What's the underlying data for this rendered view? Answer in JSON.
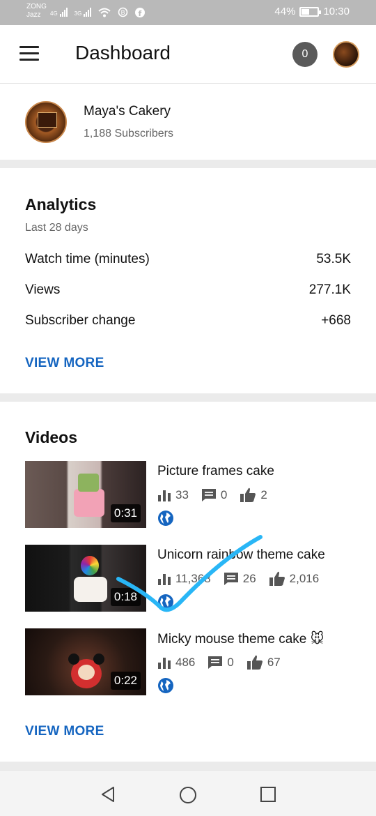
{
  "status_bar": {
    "carrier_line1": "ZONG",
    "carrier_line2": "Jazz",
    "network1": "4G",
    "network2": "3G",
    "battery": "44%",
    "battery_level": 0.44,
    "time": "10:30"
  },
  "app_bar": {
    "title": "Dashboard",
    "notification_count": "0"
  },
  "channel": {
    "name": "Maya's Cakery",
    "subscribers": "1,188 Subscribers"
  },
  "analytics": {
    "title": "Analytics",
    "period": "Last 28 days",
    "rows": [
      {
        "label": "Watch time (minutes)",
        "value": "53.5K"
      },
      {
        "label": "Views",
        "value": "277.1K"
      },
      {
        "label": "Subscriber change",
        "value": "+668"
      }
    ],
    "view_more": "VIEW MORE"
  },
  "videos": {
    "title": "Videos",
    "items": [
      {
        "title": "Picture frames cake",
        "duration": "0:31",
        "views": "33",
        "comments": "0",
        "likes": "2"
      },
      {
        "title": "Unicorn rainbow theme cake",
        "duration": "0:18",
        "views": "11,368",
        "comments": "26",
        "likes": "2,016"
      },
      {
        "title": "Micky mouse theme cake 🐭",
        "duration": "0:22",
        "views": "486",
        "comments": "0",
        "likes": "67"
      }
    ],
    "view_more": "VIEW MORE"
  },
  "colors": {
    "accent": "#1565c0",
    "annotation": "#29b6f6"
  },
  "icons": [
    "menu-icon",
    "bar-chart-icon",
    "comment-icon",
    "thumbs-up-icon",
    "globe-icon",
    "back-icon",
    "home-icon",
    "recents-icon"
  ]
}
